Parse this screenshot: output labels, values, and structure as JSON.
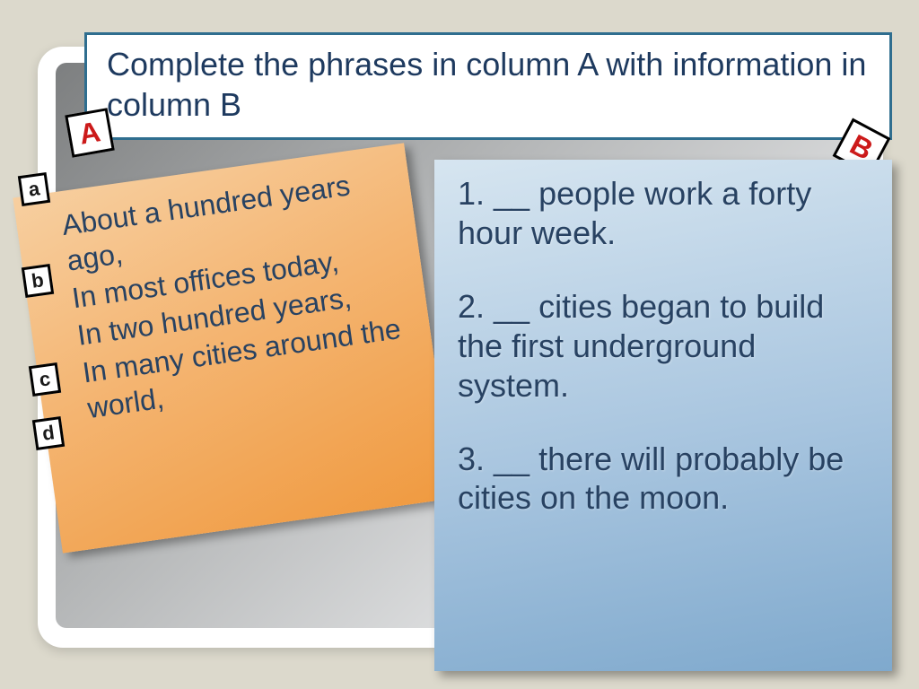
{
  "instruction": "Complete the phrases in column A with information in column B",
  "labels": {
    "colA": "A",
    "colB": "B"
  },
  "columnA": {
    "items": [
      {
        "letter": "a",
        "text": "About a hundred years ago,"
      },
      {
        "letter": "b",
        "text": "In most offices today,"
      },
      {
        "letter": "c",
        "text": "In two hundred years,"
      },
      {
        "letter": "d",
        "text": "In many cities around the world,"
      }
    ]
  },
  "columnB": {
    "items": [
      "1. __ people work a forty hour week.",
      "2. __ cities began to build the first underground system.",
      "3. __ there will probably be cities on the moon."
    ]
  }
}
